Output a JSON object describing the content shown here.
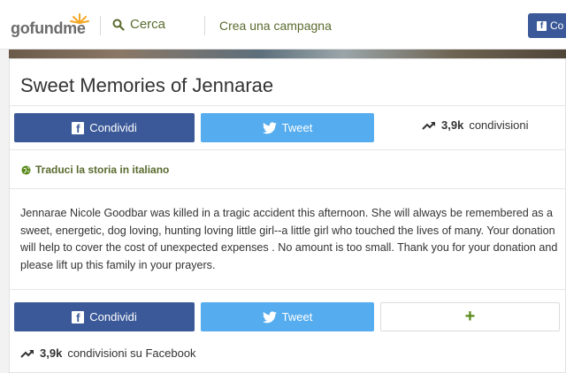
{
  "header": {
    "logo": {
      "go": "go",
      "fund": "fund",
      "me": "me"
    },
    "search_label": "Cerca",
    "create_label": "Crea una campagna",
    "login_label": "Co"
  },
  "campaign": {
    "title": "Sweet Memories of Jennarae",
    "top_share": {
      "facebook_label": "Condividi",
      "tweet_label": "Tweet",
      "share_count": "3,9k",
      "share_suffix": "condivisioni"
    },
    "translate_label": "Traduci la storia in italiano",
    "story": "Jennarae Nicole Goodbar was killed in a tragic accident this afternoon.  She will always be remembered as a sweet, energetic, dog loving, hunting loving little girl--a little girl who touched the lives of many.  Your donation will help to cover the cost of unexpected expenses . No amount is too small. Thank you for your donation and please lift up this family in your prayers.",
    "bottom_share": {
      "facebook_label": "Condividi",
      "tweet_label": "Tweet",
      "plus_label": "+",
      "share_count": "3,9k",
      "share_suffix": "condivisioni su Facebook"
    }
  },
  "colors": {
    "facebook": "#3b5998",
    "twitter": "#55acee",
    "brand_green": "#5a6b2f",
    "logo_sun": "#f5a623"
  },
  "icons": [
    "search-icon",
    "facebook-icon",
    "twitter-icon",
    "trending-icon",
    "globe-icon",
    "plus-icon"
  ]
}
